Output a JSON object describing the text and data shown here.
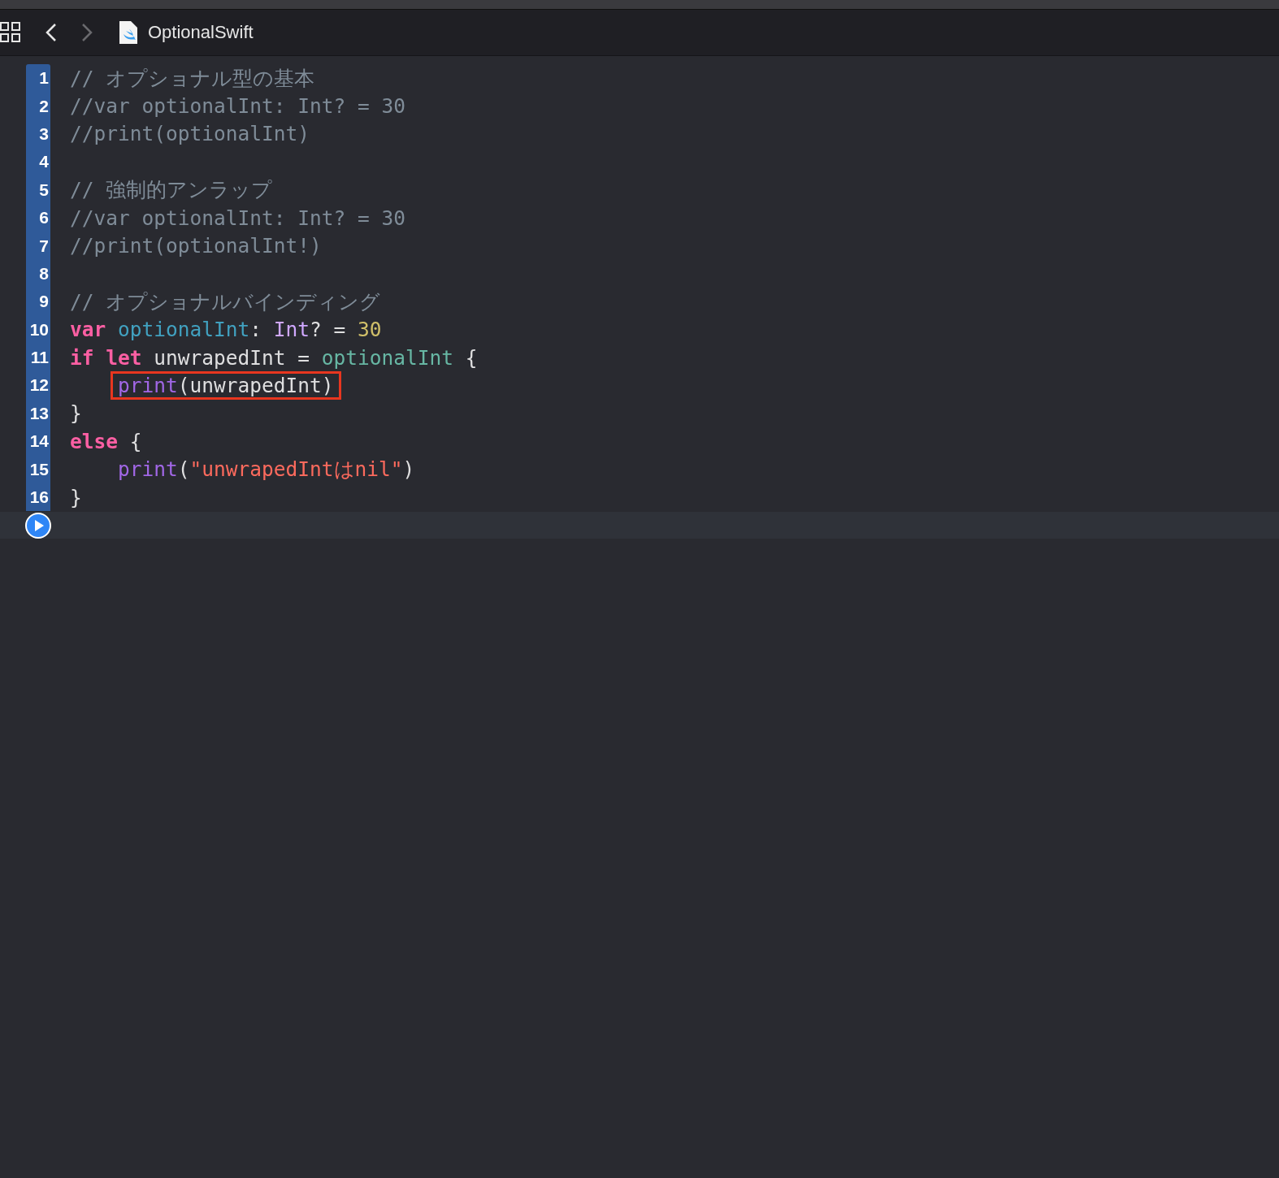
{
  "toolbar": {
    "file_name": "OptionalSwift"
  },
  "editor": {
    "lines": [
      {
        "number": "1",
        "tokens": [
          {
            "kind": "comment",
            "text": "// オプショナル型の基本"
          }
        ]
      },
      {
        "number": "2",
        "tokens": [
          {
            "kind": "comment",
            "text": "//var optionalInt: Int? = 30"
          }
        ]
      },
      {
        "number": "3",
        "tokens": [
          {
            "kind": "comment",
            "text": "//print(optionalInt)"
          }
        ]
      },
      {
        "number": "4"
      },
      {
        "number": "5",
        "tokens": [
          {
            "kind": "comment",
            "text": "// 強制的アンラップ"
          }
        ]
      },
      {
        "number": "6",
        "tokens": [
          {
            "kind": "comment",
            "text": "//var optionalInt: Int? = 30"
          }
        ]
      },
      {
        "number": "7",
        "tokens": [
          {
            "kind": "comment",
            "text": "//print(optionalInt!)"
          }
        ]
      },
      {
        "number": "8"
      },
      {
        "number": "9",
        "tokens": [
          {
            "kind": "comment",
            "text": "// オプショナルバインディング"
          }
        ]
      },
      {
        "number": "10",
        "tokens": [
          {
            "kind": "keyword",
            "text": "var"
          },
          {
            "kind": "declaration",
            "text": " optionalInt"
          },
          {
            "kind": "plain",
            "text": ": "
          },
          {
            "kind": "type",
            "text": "Int"
          },
          {
            "kind": "plain",
            "text": "? = "
          },
          {
            "kind": "number",
            "text": "30"
          }
        ]
      },
      {
        "number": "11",
        "tokens": [
          {
            "kind": "keyword",
            "text": "if let"
          },
          {
            "kind": "plain",
            "text": " unwrapedInt = "
          },
          {
            "kind": "reference",
            "text": "optionalInt"
          },
          {
            "kind": "plain",
            "text": " {"
          }
        ]
      },
      {
        "number": "12",
        "highlighted": true,
        "tokens": [
          {
            "kind": "function",
            "text": "    print"
          },
          {
            "kind": "plain",
            "text": "(unwrapedInt)"
          }
        ]
      },
      {
        "number": "13",
        "tokens": [
          {
            "kind": "plain",
            "text": "}"
          }
        ]
      },
      {
        "number": "14",
        "tokens": [
          {
            "kind": "keyword",
            "text": "else"
          },
          {
            "kind": "plain",
            "text": " {"
          }
        ]
      },
      {
        "number": "15",
        "tokens": [
          {
            "kind": "function",
            "text": "    print"
          },
          {
            "kind": "plain",
            "text": "("
          },
          {
            "kind": "string",
            "text": "\"unwrapedIntはnil\""
          },
          {
            "kind": "plain",
            "text": ")"
          }
        ]
      },
      {
        "number": "16",
        "tokens": [
          {
            "kind": "plain",
            "text": "}"
          }
        ]
      }
    ]
  }
}
